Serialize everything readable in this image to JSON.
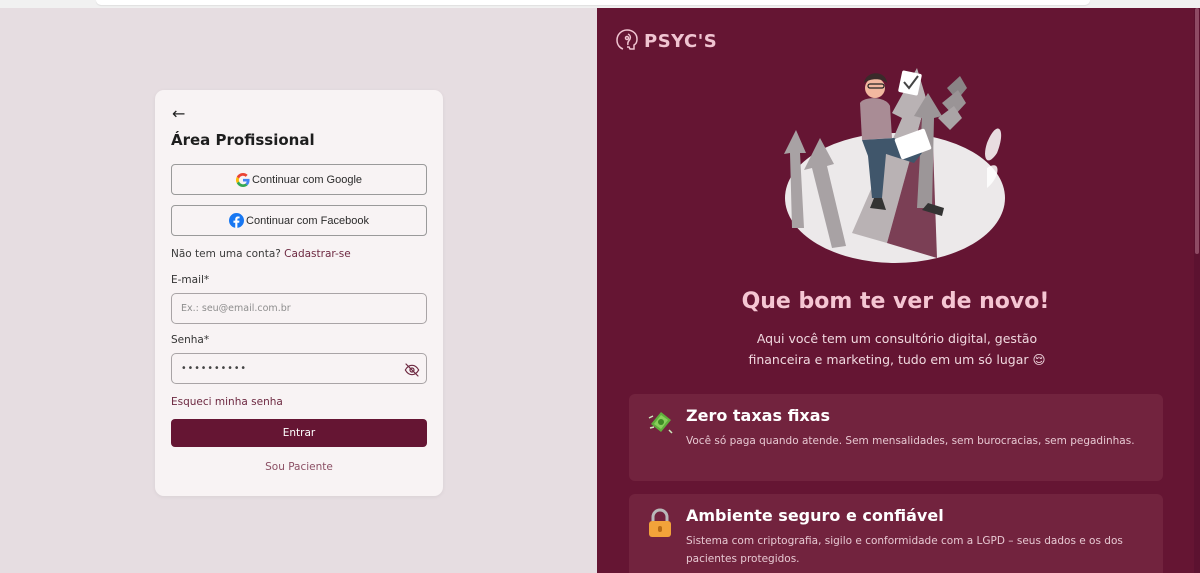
{
  "login": {
    "back_arrow": "←",
    "title": "Área Profissional",
    "google_label": "Continuar com Google",
    "facebook_label": "Continuar com Facebook",
    "signup_prompt": "Não tem uma conta?",
    "signup_link": "Cadastrar-se",
    "email_label": "E-mail*",
    "email_placeholder": "Ex.: seu@email.com.br",
    "email_value": "",
    "password_label": "Senha*",
    "password_value": "••••••••••",
    "forgot_link": "Esqueci minha senha",
    "submit_label": "Entrar",
    "patient_link": "Sou Paciente"
  },
  "brand": {
    "name": "PSYC'S",
    "accent_color": "#651533",
    "highlight_color": "#f5c6d3"
  },
  "hero": {
    "title": "Que bom te ver de novo!",
    "subtitle": "Aqui você tem um consultório digital, gestão financeira e marketing, tudo em um só lugar 😌"
  },
  "features": [
    {
      "icon": "money-icon",
      "title": "Zero taxas fixas",
      "description": "Você só paga quando atende. Sem mensalidades, sem burocracias, sem pegadinhas."
    },
    {
      "icon": "lock-icon",
      "title": "Ambiente seguro e confiável",
      "description": "Sistema com criptografia, sigilo e conformidade com a LGPD – seus dados e os dos pacientes protegidos."
    }
  ]
}
